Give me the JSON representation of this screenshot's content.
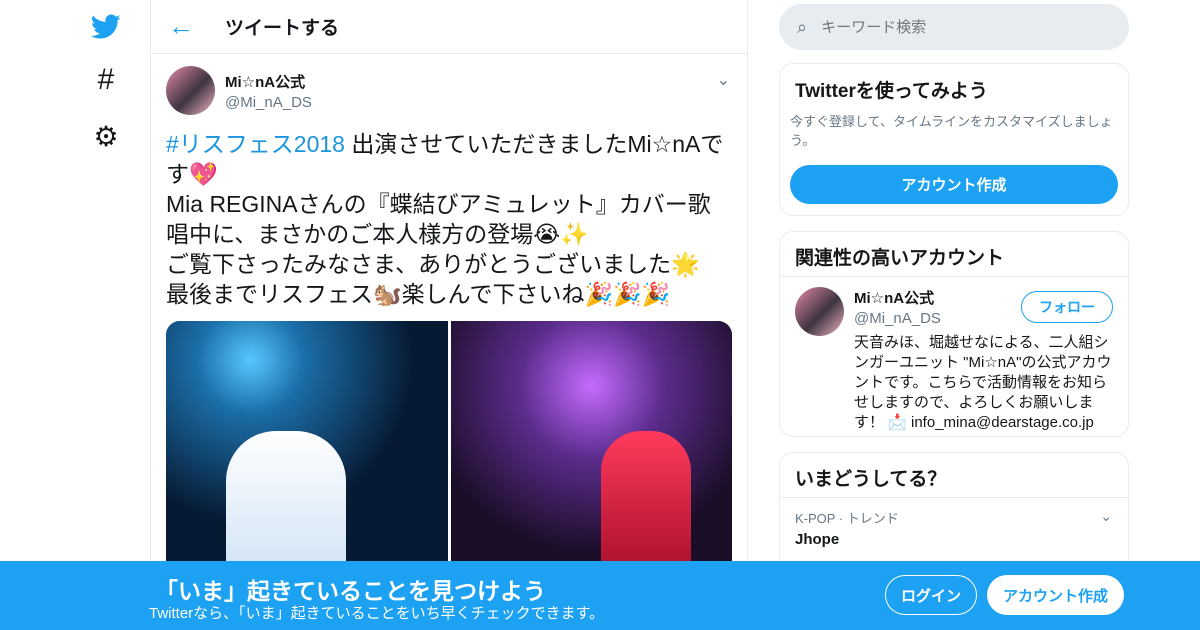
{
  "nav": {
    "logo_icon": "twitter-bird-icon",
    "explore_icon": "hashtag-icon",
    "settings_icon": "gear-icon"
  },
  "header": {
    "title": "ツイートする",
    "back_icon": "back-arrow-icon"
  },
  "tweet": {
    "author_name": "Mi☆nA公式",
    "author_handle": "@Mi_nA_DS",
    "hashtag": "#リスフェス2018",
    "text": " 出演させていただきましたMi☆nAです💖\nMia REGINAさんの『蝶結びアミュレット』カバー歌唱中に、まさかのご本人様方の登場😭✨\nご覧下さったみなさま、ありがとうございました🌟\n最後までリスフェス🐿️楽しんで下さいね🎉🎉🎉"
  },
  "sidebar": {
    "search_placeholder": "キーワード検索",
    "signup_card": {
      "title": "Twitterを使ってみよう",
      "desc": "今すぐ登録して、タイムラインをカスタマイズしましょう。",
      "button": "アカウント作成"
    },
    "related": {
      "title": "関連性の高いアカウント",
      "name": "Mi☆nA公式",
      "handle": "@Mi_nA_DS",
      "follow": "フォロー",
      "bio": "天音みほ、堀越せなによる、二人組シンガーユニット \"Mi☆nA\"の公式アカウントです。こちらで活動情報をお知らせしますので、よろしくお願いします！ 📩 info_mina@dearstage.co.jp"
    },
    "trends": {
      "title": "いまどうしてる？",
      "meta": "K-POP · トレンド",
      "name": "Jhope"
    }
  },
  "banner": {
    "title": "「いま」起きていることを見つけよう",
    "subtitle": "Twitterなら、「いま」起きていることをいち早くチェックできます。",
    "login": "ログイン",
    "signup": "アカウント作成"
  },
  "colors": {
    "accent": "#1da1f2",
    "text": "#14171a",
    "muted": "#657786"
  }
}
